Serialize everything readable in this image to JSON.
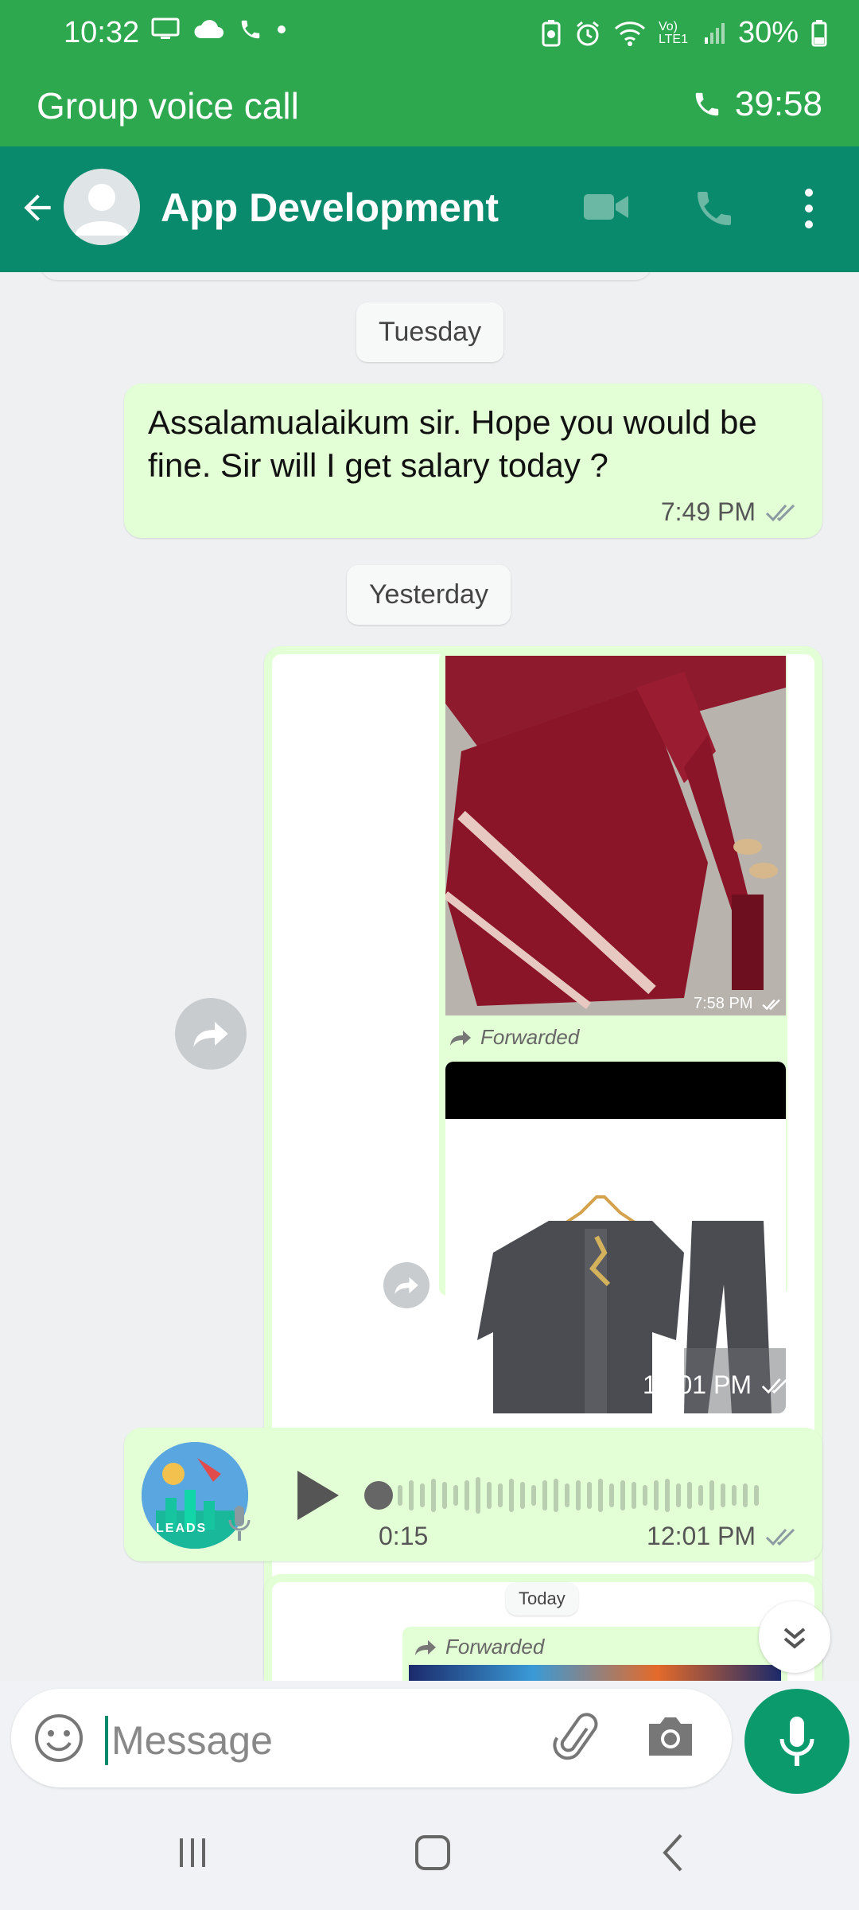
{
  "status_bar": {
    "time": "10:32",
    "battery": "30%",
    "network": "Vo) LTE1"
  },
  "call_banner": {
    "label": "Group voice call",
    "timer": "39:58"
  },
  "header": {
    "title": "App Development"
  },
  "chat": {
    "date_1": "Tuesday",
    "message_1": {
      "text": "Assalamualaikum sir. Hope you would be fine. Sir will I get salary today ?",
      "time": "7:49 PM"
    },
    "date_2": "Yesterday",
    "image_1": {
      "time": "7:58 PM"
    },
    "image_2": {
      "forwarded_label": "Forwarded",
      "time": "12:01 PM"
    },
    "voice_note": {
      "duration": "0:15",
      "time": "12:01 PM",
      "avatar_text": "LEADS"
    },
    "date_3": "Today",
    "partial_forward": {
      "forwarded_label": "Forwarded"
    }
  },
  "input": {
    "placeholder": "Message"
  },
  "colors": {
    "status_green": "#2ea84f",
    "header_teal": "#0a8a6c",
    "bubble_green": "#e3ffd6",
    "mic_button": "#0a9a6c"
  }
}
